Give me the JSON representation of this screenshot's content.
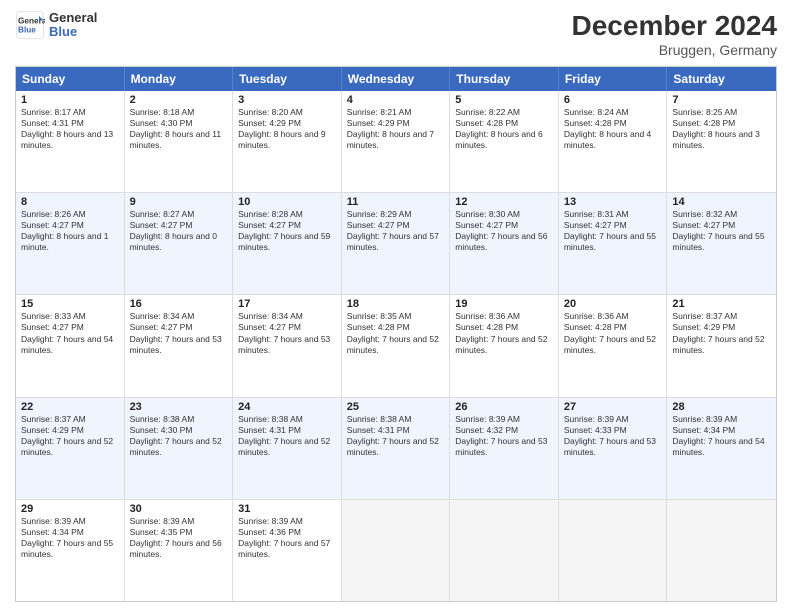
{
  "logo": {
    "line1": "General",
    "line2": "Blue"
  },
  "title": "December 2024",
  "subtitle": "Bruggen, Germany",
  "days": [
    "Sunday",
    "Monday",
    "Tuesday",
    "Wednesday",
    "Thursday",
    "Friday",
    "Saturday"
  ],
  "rows": [
    [
      {
        "day": "1",
        "sunrise": "Sunrise: 8:17 AM",
        "sunset": "Sunset: 4:31 PM",
        "daylight": "Daylight: 8 hours and 13 minutes."
      },
      {
        "day": "2",
        "sunrise": "Sunrise: 8:18 AM",
        "sunset": "Sunset: 4:30 PM",
        "daylight": "Daylight: 8 hours and 11 minutes."
      },
      {
        "day": "3",
        "sunrise": "Sunrise: 8:20 AM",
        "sunset": "Sunset: 4:29 PM",
        "daylight": "Daylight: 8 hours and 9 minutes."
      },
      {
        "day": "4",
        "sunrise": "Sunrise: 8:21 AM",
        "sunset": "Sunset: 4:29 PM",
        "daylight": "Daylight: 8 hours and 7 minutes."
      },
      {
        "day": "5",
        "sunrise": "Sunrise: 8:22 AM",
        "sunset": "Sunset: 4:28 PM",
        "daylight": "Daylight: 8 hours and 6 minutes."
      },
      {
        "day": "6",
        "sunrise": "Sunrise: 8:24 AM",
        "sunset": "Sunset: 4:28 PM",
        "daylight": "Daylight: 8 hours and 4 minutes."
      },
      {
        "day": "7",
        "sunrise": "Sunrise: 8:25 AM",
        "sunset": "Sunset: 4:28 PM",
        "daylight": "Daylight: 8 hours and 3 minutes."
      }
    ],
    [
      {
        "day": "8",
        "sunrise": "Sunrise: 8:26 AM",
        "sunset": "Sunset: 4:27 PM",
        "daylight": "Daylight: 8 hours and 1 minute."
      },
      {
        "day": "9",
        "sunrise": "Sunrise: 8:27 AM",
        "sunset": "Sunset: 4:27 PM",
        "daylight": "Daylight: 8 hours and 0 minutes."
      },
      {
        "day": "10",
        "sunrise": "Sunrise: 8:28 AM",
        "sunset": "Sunset: 4:27 PM",
        "daylight": "Daylight: 7 hours and 59 minutes."
      },
      {
        "day": "11",
        "sunrise": "Sunrise: 8:29 AM",
        "sunset": "Sunset: 4:27 PM",
        "daylight": "Daylight: 7 hours and 57 minutes."
      },
      {
        "day": "12",
        "sunrise": "Sunrise: 8:30 AM",
        "sunset": "Sunset: 4:27 PM",
        "daylight": "Daylight: 7 hours and 56 minutes."
      },
      {
        "day": "13",
        "sunrise": "Sunrise: 8:31 AM",
        "sunset": "Sunset: 4:27 PM",
        "daylight": "Daylight: 7 hours and 55 minutes."
      },
      {
        "day": "14",
        "sunrise": "Sunrise: 8:32 AM",
        "sunset": "Sunset: 4:27 PM",
        "daylight": "Daylight: 7 hours and 55 minutes."
      }
    ],
    [
      {
        "day": "15",
        "sunrise": "Sunrise: 8:33 AM",
        "sunset": "Sunset: 4:27 PM",
        "daylight": "Daylight: 7 hours and 54 minutes."
      },
      {
        "day": "16",
        "sunrise": "Sunrise: 8:34 AM",
        "sunset": "Sunset: 4:27 PM",
        "daylight": "Daylight: 7 hours and 53 minutes."
      },
      {
        "day": "17",
        "sunrise": "Sunrise: 8:34 AM",
        "sunset": "Sunset: 4:27 PM",
        "daylight": "Daylight: 7 hours and 53 minutes."
      },
      {
        "day": "18",
        "sunrise": "Sunrise: 8:35 AM",
        "sunset": "Sunset: 4:28 PM",
        "daylight": "Daylight: 7 hours and 52 minutes."
      },
      {
        "day": "19",
        "sunrise": "Sunrise: 8:36 AM",
        "sunset": "Sunset: 4:28 PM",
        "daylight": "Daylight: 7 hours and 52 minutes."
      },
      {
        "day": "20",
        "sunrise": "Sunrise: 8:36 AM",
        "sunset": "Sunset: 4:28 PM",
        "daylight": "Daylight: 7 hours and 52 minutes."
      },
      {
        "day": "21",
        "sunrise": "Sunrise: 8:37 AM",
        "sunset": "Sunset: 4:29 PM",
        "daylight": "Daylight: 7 hours and 52 minutes."
      }
    ],
    [
      {
        "day": "22",
        "sunrise": "Sunrise: 8:37 AM",
        "sunset": "Sunset: 4:29 PM",
        "daylight": "Daylight: 7 hours and 52 minutes."
      },
      {
        "day": "23",
        "sunrise": "Sunrise: 8:38 AM",
        "sunset": "Sunset: 4:30 PM",
        "daylight": "Daylight: 7 hours and 52 minutes."
      },
      {
        "day": "24",
        "sunrise": "Sunrise: 8:38 AM",
        "sunset": "Sunset: 4:31 PM",
        "daylight": "Daylight: 7 hours and 52 minutes."
      },
      {
        "day": "25",
        "sunrise": "Sunrise: 8:38 AM",
        "sunset": "Sunset: 4:31 PM",
        "daylight": "Daylight: 7 hours and 52 minutes."
      },
      {
        "day": "26",
        "sunrise": "Sunrise: 8:39 AM",
        "sunset": "Sunset: 4:32 PM",
        "daylight": "Daylight: 7 hours and 53 minutes."
      },
      {
        "day": "27",
        "sunrise": "Sunrise: 8:39 AM",
        "sunset": "Sunset: 4:33 PM",
        "daylight": "Daylight: 7 hours and 53 minutes."
      },
      {
        "day": "28",
        "sunrise": "Sunrise: 8:39 AM",
        "sunset": "Sunset: 4:34 PM",
        "daylight": "Daylight: 7 hours and 54 minutes."
      }
    ],
    [
      {
        "day": "29",
        "sunrise": "Sunrise: 8:39 AM",
        "sunset": "Sunset: 4:34 PM",
        "daylight": "Daylight: 7 hours and 55 minutes."
      },
      {
        "day": "30",
        "sunrise": "Sunrise: 8:39 AM",
        "sunset": "Sunset: 4:35 PM",
        "daylight": "Daylight: 7 hours and 56 minutes."
      },
      {
        "day": "31",
        "sunrise": "Sunrise: 8:39 AM",
        "sunset": "Sunset: 4:36 PM",
        "daylight": "Daylight: 7 hours and 57 minutes."
      },
      {
        "day": "",
        "sunrise": "",
        "sunset": "",
        "daylight": ""
      },
      {
        "day": "",
        "sunrise": "",
        "sunset": "",
        "daylight": ""
      },
      {
        "day": "",
        "sunrise": "",
        "sunset": "",
        "daylight": ""
      },
      {
        "day": "",
        "sunrise": "",
        "sunset": "",
        "daylight": ""
      }
    ]
  ]
}
